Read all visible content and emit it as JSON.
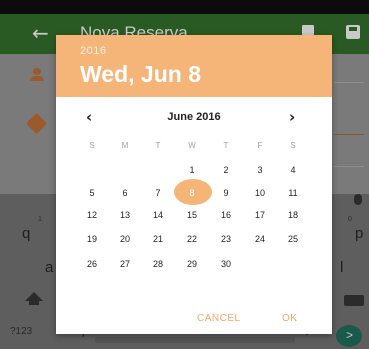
{
  "app": {
    "title": "Nova Reserva",
    "back_icon": "arrow-back-icon",
    "delete_icon": "trash-icon",
    "save_icon": "save-icon"
  },
  "keyboard": {
    "keys": [
      "q",
      "p",
      "a",
      "l",
      ",",
      "."
    ],
    "number_hints": [
      "1",
      "0"
    ],
    "symbols_label": "?123"
  },
  "date_picker": {
    "year": "2016",
    "selected_date": "Wed, Jun 8",
    "month_label": "June 2016",
    "prev_icon": "‹",
    "next_icon": "›",
    "weekdays": [
      "S",
      "M",
      "T",
      "W",
      "T",
      "F",
      "S"
    ],
    "weeks": [
      [
        "",
        "",
        "",
        "1",
        "2",
        "3",
        "4"
      ],
      [
        "5",
        "6",
        "7",
        "8",
        "9",
        "10",
        "11"
      ],
      [
        "12",
        "13",
        "14",
        "15",
        "16",
        "17",
        "18"
      ],
      [
        "19",
        "20",
        "21",
        "22",
        "23",
        "24",
        "25"
      ],
      [
        "26",
        "27",
        "28",
        "29",
        "30",
        "",
        ""
      ]
    ],
    "selected_day": "8",
    "cancel_label": "CANCEL",
    "ok_label": "OK"
  },
  "colors": {
    "header": "#f5b579",
    "accent": "#f2a760",
    "app_bar": "#2a5a23"
  }
}
